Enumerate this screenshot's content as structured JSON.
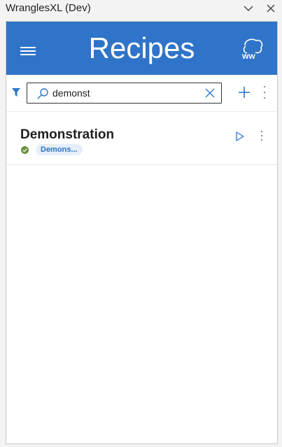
{
  "window": {
    "title": "WranglesXL (Dev)"
  },
  "header": {
    "title": "Recipes",
    "menu_icon": "hamburger-icon",
    "logo_icon": "wrangles-logo-icon"
  },
  "search": {
    "value": "demonst",
    "placeholder": "Search"
  },
  "recipes": [
    {
      "name": "Demonstration",
      "tag": "Demons...",
      "status": "ok"
    }
  ],
  "colors": {
    "brand": "#2f74c9",
    "status_ok": "#6b8f3a",
    "tag_bg": "#e5eefa"
  }
}
